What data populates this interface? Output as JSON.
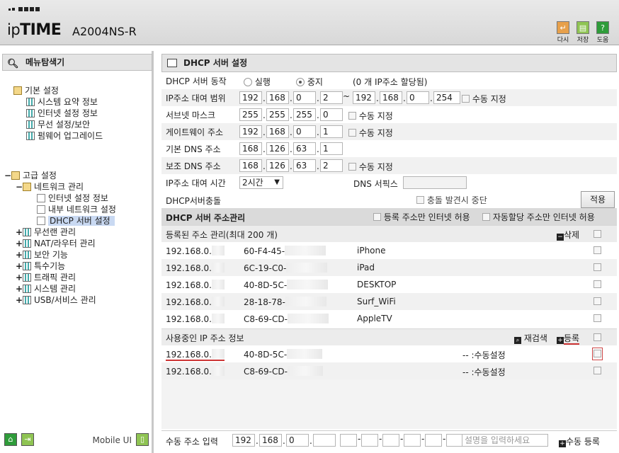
{
  "header": {
    "logo_prefix": "ip",
    "logo_brand": "TIME",
    "model": "A2004NS-R",
    "tools": [
      {
        "label": "다시",
        "icon": "undo-icon",
        "glyph": "↵",
        "color": "#e7a04b"
      },
      {
        "label": "저장",
        "icon": "save-icon",
        "glyph": "▤",
        "color": "#8fc453"
      },
      {
        "label": "도움",
        "icon": "help-icon",
        "glyph": "?",
        "color": "#2f9c3a"
      }
    ]
  },
  "sidebar": {
    "title": "메뉴탐색기",
    "basic": {
      "label": "기본 설정",
      "items": [
        "시스템 요약 정보",
        "인터넷 설정 정보",
        "무선 설정/보안",
        "펌웨어 업그레이드"
      ]
    },
    "advanced": {
      "label": "고급 설정",
      "network": {
        "label": "네트워크 관리",
        "items": [
          "인터넷 설정 정보",
          "내부 네트워크 설정",
          "DHCP 서버 설정"
        ]
      },
      "items": [
        "무선랜 관리",
        "NAT/라우터 관리",
        "보안 기능",
        "특수기능",
        "트래픽 관리",
        "시스템 관리",
        "USB/서비스 관리"
      ]
    },
    "mobile_ui": "Mobile UI"
  },
  "main": {
    "title": "DHCP 서버 설정",
    "dhcp_status": {
      "label": "DHCP 서버 동작",
      "run_label": "실행",
      "stop_label": "중지",
      "selected": "중지",
      "allocated": "(0 개 IP주소 할당됨)"
    },
    "lease_range": {
      "label": "IP주소 대여 범위",
      "start": [
        "192",
        "168",
        "0",
        "2"
      ],
      "tilde": "~",
      "end": [
        "192",
        "168",
        "0",
        "254"
      ],
      "manual_label": "수동 지정"
    },
    "subnet": {
      "label": "서브넷 마스크",
      "value": [
        "255",
        "255",
        "255",
        "0"
      ],
      "manual_label": "수동 지정"
    },
    "gateway": {
      "label": "게이트웨이 주소",
      "value": [
        "192",
        "168",
        "0",
        "1"
      ],
      "manual_label": "수동 지정"
    },
    "dns1": {
      "label": "기본 DNS 주소",
      "value": [
        "168",
        "126",
        "63",
        "1"
      ]
    },
    "dns2": {
      "label": "보조 DNS 주소",
      "value": [
        "168",
        "126",
        "63",
        "2"
      ],
      "manual_label": "수동 지정"
    },
    "lease_time": {
      "label": "IP주소 대여 시간",
      "value": "2시간",
      "dns_suffix_label": "DNS 서픽스",
      "dns_suffix_value": ""
    },
    "conflict": {
      "label": "DHCP서버충돌",
      "stop_label": "충돌 발견시 중단",
      "apply_label": "적용"
    },
    "address_mgmt": {
      "title": "DHCP 서버 주소관리",
      "only_registered": "등록 주소만 인터넷 허용",
      "only_auto": "자동할당 주소만 인터넷 허용"
    },
    "registered": {
      "title": "등록된 주소 관리(최대 200 개)",
      "delete_label": "삭제",
      "rows": [
        {
          "ip": "192.168.0.",
          "mac": "60-F4-45-",
          "name": "iPhone"
        },
        {
          "ip": "192.168.0.",
          "mac": "6C-19-C0-",
          "name": "iPad"
        },
        {
          "ip": "192.168.0.",
          "mac": "40-8D-5C-",
          "name": "DESKTOP"
        },
        {
          "ip": "192.168.0.",
          "mac": "28-18-78-",
          "name": "Surf_WiFi"
        },
        {
          "ip": "192.168.0.",
          "mac": "C8-69-CD-",
          "name": "AppleTV"
        }
      ]
    },
    "in_use": {
      "title": "사용중인 IP 주소 정보",
      "refresh_label": "재검색",
      "register_label": "등록",
      "rows": [
        {
          "ip": "192.168.0.",
          "mac": "40-8D-5C-",
          "status": "-- :수동설정"
        },
        {
          "ip": "192.168.0.",
          "mac": "C8-69-CD-",
          "status": "-- :수동설정"
        }
      ]
    },
    "manual_input": {
      "label": "수동 주소 입력",
      "ip": [
        "192",
        "168",
        "0",
        ""
      ],
      "desc_placeholder": "설명을 입력하세요",
      "register_label": "수동 등록"
    }
  }
}
